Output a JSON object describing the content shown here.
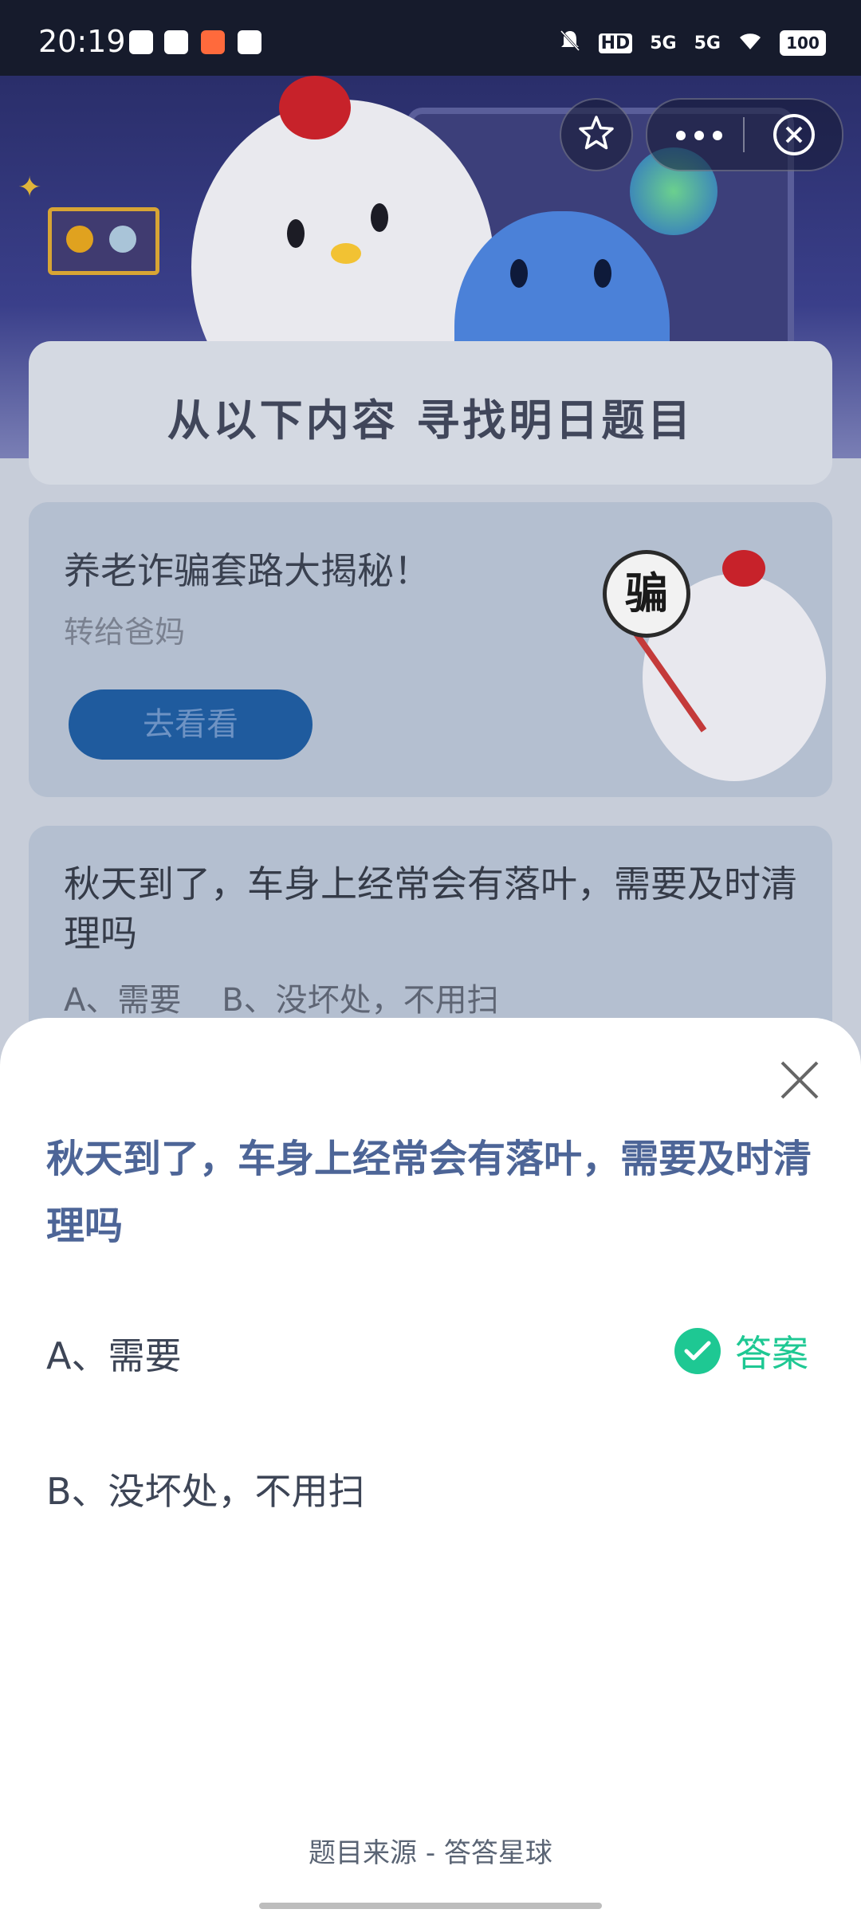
{
  "status_bar": {
    "time": "20:19",
    "network_1": "5G",
    "network_2": "5G",
    "hd": "HD",
    "battery": "100"
  },
  "top_controls": {
    "star_icon": "star-icon",
    "more_icon": "more-icon",
    "close_icon": "close-circle-icon"
  },
  "page": {
    "heading": "从以下内容 寻找明日题目",
    "card1": {
      "title": "养老诈骗套路大揭秘！",
      "subtitle": "转给爸妈",
      "button": "去看看",
      "sign_text": "骗"
    },
    "card2": {
      "question": "秋天到了，车身上经常会有落叶，需要及时清理吗",
      "options": "A、需要    B、没坏处，不用扫"
    }
  },
  "sheet": {
    "question": "秋天到了，车身上经常会有落叶，需要及时清理吗",
    "option_a": "A、需要",
    "option_b": "B、没坏处，不用扫",
    "answer_label": "答案",
    "source": "题目来源 - 答答星球"
  },
  "colors": {
    "accent_blue": "#4d6597",
    "answer_green": "#1ec893"
  }
}
